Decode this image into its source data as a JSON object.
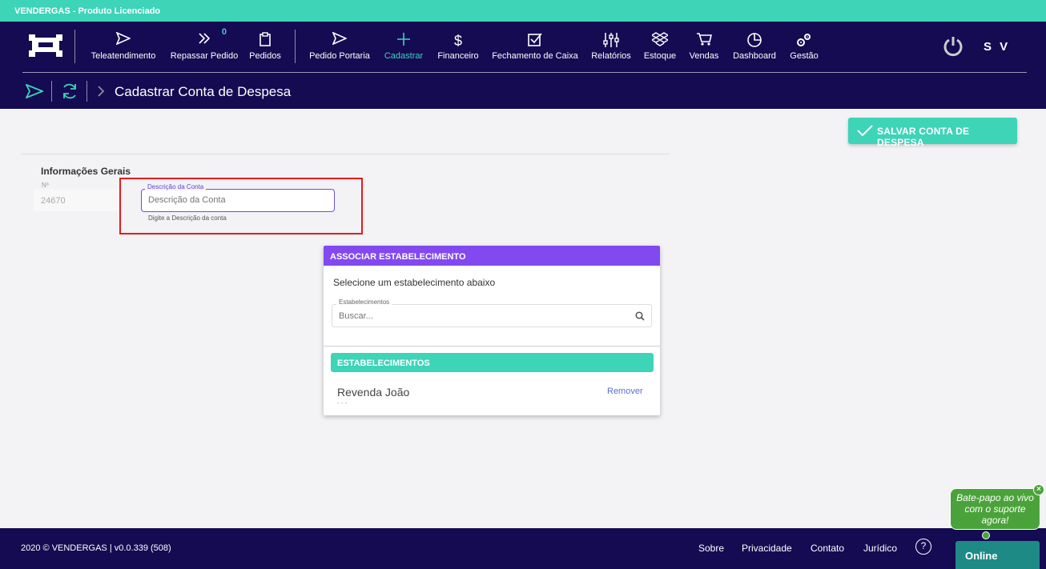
{
  "topbar": {
    "title": "VENDERGAS - Produto Licenciado"
  },
  "nav": {
    "items": [
      {
        "label": "Teleatendimento",
        "icon": "send-icon"
      },
      {
        "label": "Repassar Pedido",
        "icon": "double-chevron-icon",
        "badge": "0"
      },
      {
        "label": "Pedidos",
        "icon": "clipboard-icon"
      },
      {
        "label": "Pedido Portaria",
        "icon": "send-icon"
      },
      {
        "label": "Cadastrar",
        "icon": "plus-icon",
        "active": true
      },
      {
        "label": "Financeiro",
        "icon": "dollar-icon"
      },
      {
        "label": "Fechamento de Caixa",
        "icon": "checkbox-icon"
      },
      {
        "label": "Relatórios",
        "icon": "sliders-icon"
      },
      {
        "label": "Estoque",
        "icon": "dropbox-icon"
      },
      {
        "label": "Vendas",
        "icon": "cart-icon"
      },
      {
        "label": "Dashboard",
        "icon": "pie-chart-icon"
      },
      {
        "label": "Gestão",
        "icon": "gears-icon"
      }
    ],
    "user_initials": "S V",
    "accent_color": "#3dd4b8",
    "nav_bg": "#150b52"
  },
  "breadcrumb": {
    "title": "Cadastrar Conta de Despesa"
  },
  "actions": {
    "save_label": "SALVAR CONTA DE DESPESA"
  },
  "form": {
    "section_title": "Informações Gerais",
    "number_label": "Nº",
    "number_value": "24670",
    "description_label": "Descrição da Conta",
    "description_placeholder": "Descrição da Conta",
    "description_hint": "Digite a Descrição da conta"
  },
  "establishment_card": {
    "header": "ASSOCIAR ESTABELECIMENTO",
    "subtitle": "Selecione um estabelecimento abaixo",
    "search_label": "Estabelecimentos",
    "search_placeholder": "Buscar...",
    "list_header": "ESTABELECIMENTOS",
    "items": [
      {
        "name": "Revenda João",
        "meta": "- - -",
        "action": "Remover"
      }
    ],
    "header_color": "#8349f0"
  },
  "footer": {
    "copyright": "2020 © VENDERGAS | v0.0.339 (508)",
    "links": [
      "Sobre",
      "Privacidade",
      "Contato",
      "Jurídico"
    ],
    "help": "?"
  },
  "chat": {
    "bubble_text": "Bate-papo ao vivo com o suporte agora!",
    "close": "×",
    "status": "Online"
  }
}
